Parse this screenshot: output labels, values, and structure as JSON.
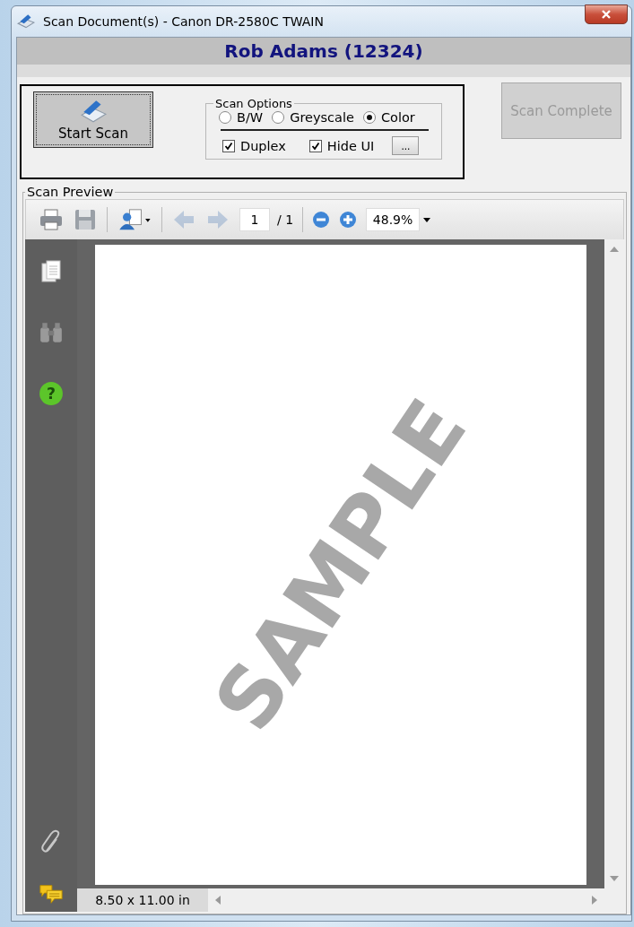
{
  "window": {
    "title": "Scan Document(s) - Canon DR-2580C TWAIN"
  },
  "header": {
    "title": "Rob Adams (12324)"
  },
  "start_button": {
    "label": "Start Scan"
  },
  "scan_options": {
    "title": "Scan Options",
    "color_modes": [
      {
        "label": "B/W",
        "selected": false
      },
      {
        "label": "Greyscale",
        "selected": false
      },
      {
        "label": "Color",
        "selected": true
      }
    ],
    "checkboxes": [
      {
        "label": "Duplex",
        "checked": true
      },
      {
        "label": "Hide UI",
        "checked": true
      }
    ],
    "more_button": "..."
  },
  "scan_complete_button": {
    "label": "Scan Complete",
    "disabled": true
  },
  "preview": {
    "title": "Scan Preview",
    "toolbar": {
      "previous_disabled": true,
      "next_disabled": true,
      "page_number": "1",
      "page_total": "/ 1",
      "zoom": "48.9%"
    },
    "side_help_symbol": "?",
    "document_text": "SAMPLE",
    "page_size": "8.50 x 11.00 in"
  }
}
